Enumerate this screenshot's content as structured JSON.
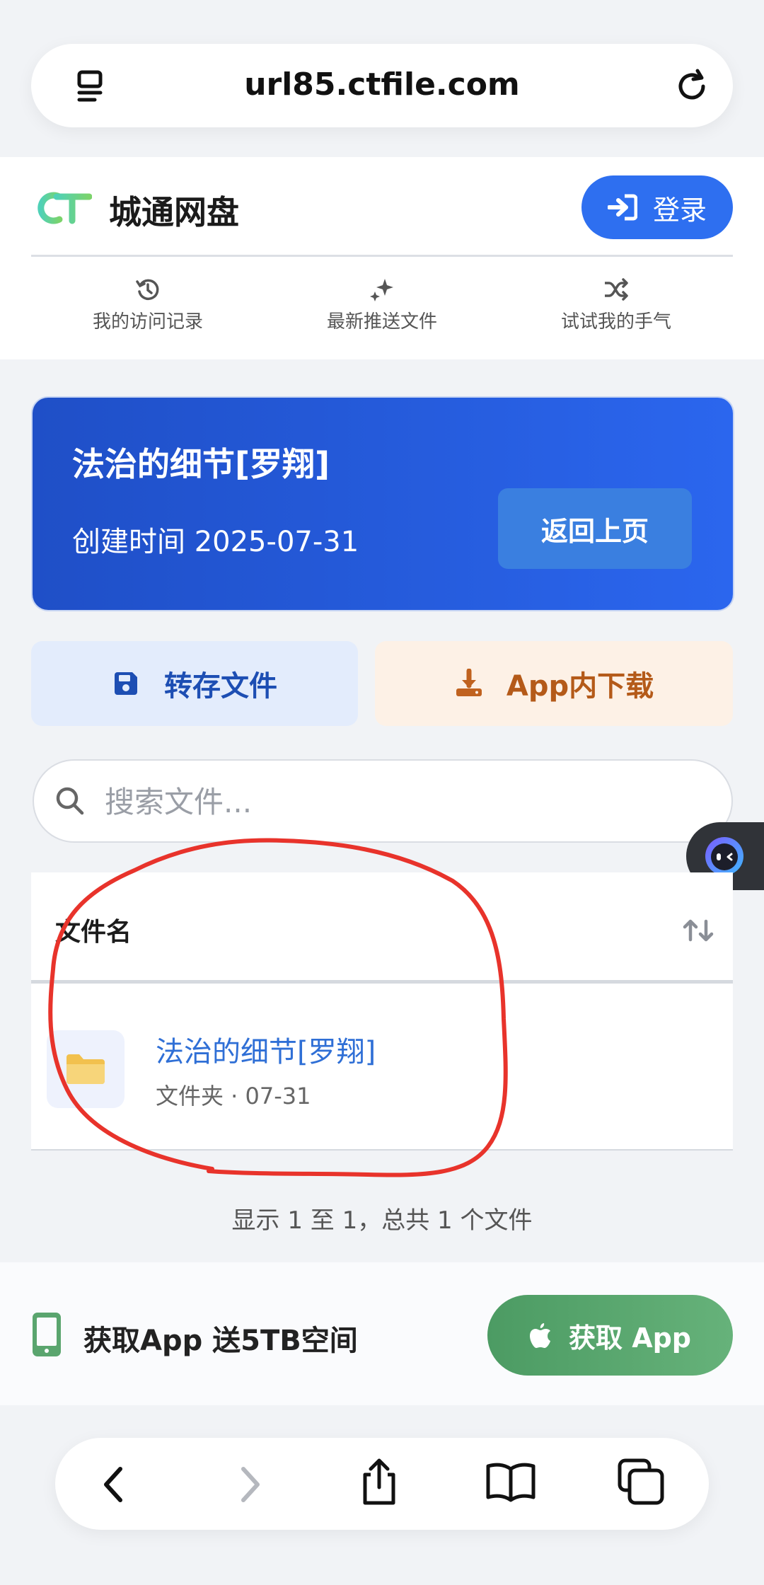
{
  "browser": {
    "url": "url85.ctfile.com"
  },
  "header": {
    "brand_name": "城通网盘",
    "login_label": "登录",
    "nav": [
      {
        "label": "我的访问记录",
        "icon": "history-icon"
      },
      {
        "label": "最新推送文件",
        "icon": "sparkle-icon"
      },
      {
        "label": "试试我的手气",
        "icon": "shuffle-icon"
      }
    ]
  },
  "folder_card": {
    "title": "法治的细节[罗翔]",
    "created": "创建时间 2025-07-31",
    "back_label": "返回上页"
  },
  "actions": {
    "save_label": "转存文件",
    "app_download_label": "App内下载"
  },
  "search": {
    "placeholder": "搜索文件..."
  },
  "table": {
    "header": "文件名",
    "rows": [
      {
        "name": "法治的细节[罗翔]",
        "meta": "文件夹 · 07-31"
      }
    ],
    "summary": "显示 1 至 1，总共 1 个文件"
  },
  "banner": {
    "text": "获取App 送5TB空间",
    "button_label": "获取 App"
  },
  "colors": {
    "accent": "#2e6ff0",
    "card": "#2558d8",
    "app_green": "#5aa56e",
    "annotation_red": "#e8332b"
  }
}
